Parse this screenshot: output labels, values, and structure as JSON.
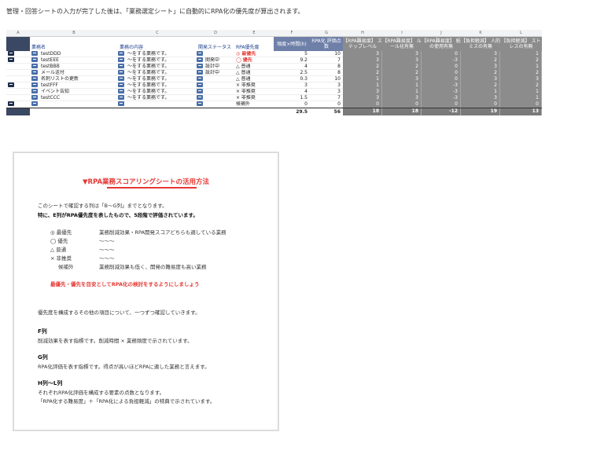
{
  "intro": "管理・回答シートの入力が完了した後は、「業務選定シート」に自動的にRPA化の優先度が算出されます。",
  "sheet": {
    "col_letters": [
      "A",
      "B",
      "C",
      "D",
      "E",
      "F",
      "G",
      "H",
      "I",
      "J",
      "K",
      "L"
    ],
    "headers": {
      "name": "業務名",
      "content": "業務の内容",
      "dev_status": "開発ステータス",
      "priority": "RPA優先度",
      "freq_time": "頻度×時間(h)",
      "rpa_score": "RPA化 評価点数",
      "h": "【RPA難易度】 ステップレベル",
      "i": "【RPA難易度】 ルール化有無",
      "j": "【RPA難易度】 紙の使用有無",
      "k": "【負担軽減】 人的ミスの有無",
      "l": "【負担軽減】 ストレスの有無"
    },
    "rows": [
      {
        "name": "testDDD",
        "content": "〜をする業務です。",
        "status": "",
        "priority": "◎ 最優先",
        "pclass": "red",
        "f": "5",
        "g": "10",
        "h": "3",
        "i": "3",
        "j": "0",
        "k": "3",
        "l": "1"
      },
      {
        "name": "testEEE",
        "content": "〜をする業務です。",
        "status": "開発中",
        "priority": "◯ 優先",
        "pclass": "red",
        "f": "9.2",
        "g": "7",
        "h": "3",
        "i": "3",
        "j": "-3",
        "k": "2",
        "l": "2"
      },
      {
        "name": "testBBB",
        "content": "〜をする業務です。",
        "status": "設計中",
        "priority": "△ 普通",
        "pclass": "",
        "f": "4",
        "g": "8",
        "h": "2",
        "i": "2",
        "j": "0",
        "k": "3",
        "l": "1"
      },
      {
        "name": "メール送付",
        "content": "〜をする業務です。",
        "status": "設計中",
        "priority": "△ 普通",
        "pclass": "",
        "f": "2.5",
        "g": "8",
        "h": "2",
        "i": "2",
        "j": "0",
        "k": "2",
        "l": "2"
      },
      {
        "name": "名刺リストの更新",
        "content": "〜をする業務です。",
        "status": "",
        "priority": "△ 普通",
        "pclass": "",
        "f": "0.3",
        "g": "10",
        "h": "1",
        "i": "3",
        "j": "0",
        "k": "3",
        "l": "3"
      },
      {
        "name": "testFFF",
        "content": "〜をする業務です。",
        "status": "",
        "priority": "× 非推奨",
        "pclass": "",
        "f": "3",
        "g": "3",
        "h": "1",
        "i": "1",
        "j": "-3",
        "k": "2",
        "l": "2"
      },
      {
        "name": "イベント告知",
        "content": "〜をする業務です。",
        "status": "",
        "priority": "× 非推奨",
        "pclass": "",
        "f": "4",
        "g": "3",
        "h": "3",
        "i": "1",
        "j": "-3",
        "k": "1",
        "l": "1"
      },
      {
        "name": "testCCC",
        "content": "〜をする業務です。",
        "status": "",
        "priority": "× 非推奨",
        "pclass": "",
        "f": "1.5",
        "g": "7",
        "h": "3",
        "i": "3",
        "j": "-3",
        "k": "3",
        "l": "1"
      },
      {
        "name": "",
        "content": "",
        "status": "",
        "priority": "候補外",
        "pclass": "",
        "f": "0",
        "g": "0",
        "h": "0",
        "i": "0",
        "j": "0",
        "k": "0",
        "l": "0"
      }
    ],
    "totals": {
      "f": "29.5",
      "g": "56",
      "h": "18",
      "i": "18",
      "j": "-12",
      "k": "19",
      "l": "13"
    }
  },
  "guide": {
    "title": "▼RPA業務スコアリングシートの活用方法",
    "p1": "このシートで確認する列は「B〜G列」までとなります。",
    "p2": "特に、E列がRPA優先度を表したもので、5段階で評価されています。",
    "levels": [
      {
        "label": "◎ 最優先",
        "desc": "業務削減効果・RPA開発スコアどちらも適している業務"
      },
      {
        "label": "◯ 優先",
        "desc": "〜〜〜"
      },
      {
        "label": "△ 普通",
        "desc": "〜〜〜"
      },
      {
        "label": "× 非推奨",
        "desc": "〜〜〜"
      },
      {
        "label": "候補外",
        "desc": "業務削減効果も低く、開発の難易度も高い業務"
      }
    ],
    "note": "最優先・優先を目安としてRPA化の検討をするようにしましょう",
    "p3": "優先度を構成するその他の項目について、一つずつ確認していきます。",
    "f_head": "F列",
    "f_text": "削減効果を表す指標です。削減時間 × 業務頻度で示されています。",
    "g_head": "G列",
    "g_text": "RPA化評価を表す指標です。得点が高いほどRPAに適した業務と言えます。",
    "hl_head": "H列〜L列",
    "hl_text1": "それぞれRPA化評価を構成する要素の点数となります。",
    "hl_text2": "「RPA化する難易度」＋「RPA化による負担軽減」の特典で示されています。"
  }
}
